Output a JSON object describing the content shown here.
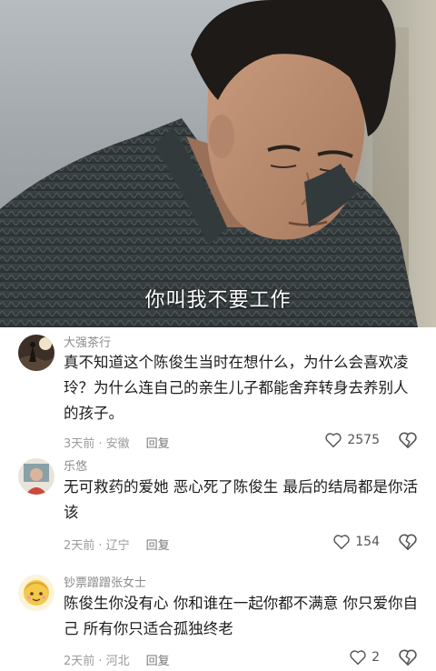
{
  "video": {
    "subtitle": "你叫我不要工作"
  },
  "comments": [
    {
      "username": "大强茶行",
      "text": "真不知道这个陈俊生当时在想什么，为什么会喜欢凌玲？为什么连自己的亲生儿子都能舍弃转身去养别人的孩子。",
      "time_location": "3天前 · 安徽",
      "reply_label": "回复",
      "likes": "2575"
    },
    {
      "username": "乐悠",
      "text": "无可救药的爱她 恶心死了陈俊生 最后的结局都是你活该",
      "time_location": "2天前 · 辽宁",
      "reply_label": "回复",
      "likes": "154"
    },
    {
      "username": "钞票蹭蹭张女士",
      "text": "陈俊生你没有心 你和谁在一起你都不满意 你只爱你自己 所有你只适合孤独终老",
      "time_location": "2天前 · 河北",
      "reply_label": "回复",
      "likes": "2"
    }
  ],
  "icons": {
    "like": "heart-outline-icon",
    "dislike": "broken-heart-icon"
  }
}
